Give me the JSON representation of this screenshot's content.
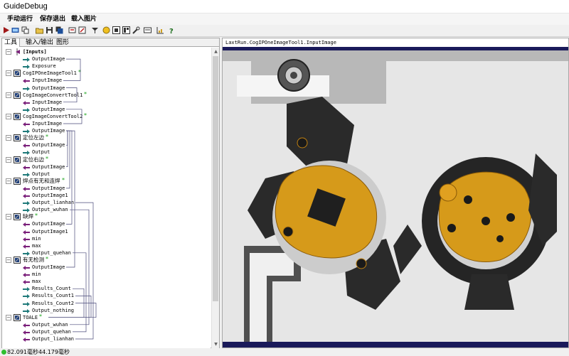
{
  "window": {
    "title": "GuideDebug"
  },
  "menu": [
    {
      "label": "手动运行"
    },
    {
      "label": "保存退出"
    },
    {
      "label": "载入图片"
    }
  ],
  "toolbar_icons": [
    "run-icon",
    "display-icon",
    "copy-icon",
    "open-folder-icon",
    "save-icon",
    "save-all-icon",
    "import-icon",
    "settings-icon",
    "filter-icon",
    "image-icon",
    "grid-icon",
    "layout-icon",
    "keyboard-icon",
    "chart-icon",
    "help-icon"
  ],
  "tabs": [
    {
      "label": "工具",
      "active": true
    },
    {
      "label": "输入/输出",
      "active": false
    },
    {
      "label": "图形",
      "active": false
    }
  ],
  "tree": [
    {
      "type": "group",
      "label": "[Inputs]",
      "bold": true
    },
    {
      "type": "port",
      "dir": "out",
      "label": "OutputImage"
    },
    {
      "type": "port",
      "dir": "out",
      "label": "Exposure"
    },
    {
      "type": "tool",
      "label": "CogIPOneImageTool1",
      "star": true
    },
    {
      "type": "port",
      "dir": "in",
      "label": "InputImage"
    },
    {
      "type": "port",
      "dir": "out",
      "label": "OutputImage"
    },
    {
      "type": "tool",
      "label": "CogImageConvertTool1",
      "star": true
    },
    {
      "type": "port",
      "dir": "in",
      "label": "InputImage"
    },
    {
      "type": "port",
      "dir": "out",
      "label": "OutputImage"
    },
    {
      "type": "tool",
      "label": "CogImageConvertTool2",
      "star": true
    },
    {
      "type": "port",
      "dir": "in",
      "label": "InputImage"
    },
    {
      "type": "port",
      "dir": "out",
      "label": "OutputImage"
    },
    {
      "type": "tool",
      "label": "定位左边",
      "star": true,
      "cn": true
    },
    {
      "type": "port",
      "dir": "in",
      "label": "OutputImage"
    },
    {
      "type": "port",
      "dir": "out",
      "label": "Output"
    },
    {
      "type": "tool",
      "label": "定位右边",
      "star": true,
      "cn": true
    },
    {
      "type": "port",
      "dir": "in",
      "label": "OutputImage"
    },
    {
      "type": "port",
      "dir": "out",
      "label": "Output"
    },
    {
      "type": "tool",
      "label": "焊点有无和连焊",
      "star": true,
      "cn": true
    },
    {
      "type": "port",
      "dir": "in",
      "label": "OutputImage"
    },
    {
      "type": "port",
      "dir": "in",
      "label": "OutputImage1"
    },
    {
      "type": "port",
      "dir": "out",
      "label": "Output_lianhan"
    },
    {
      "type": "port",
      "dir": "out",
      "label": "Output_wuhan"
    },
    {
      "type": "tool",
      "label": "缺焊",
      "star": true,
      "cn": true
    },
    {
      "type": "port",
      "dir": "in",
      "label": "OutputImage"
    },
    {
      "type": "port",
      "dir": "in",
      "label": "OutputImage1"
    },
    {
      "type": "port",
      "dir": "in",
      "label": "min"
    },
    {
      "type": "port",
      "dir": "in",
      "label": "max"
    },
    {
      "type": "port",
      "dir": "out",
      "label": "Output_quehan"
    },
    {
      "type": "tool",
      "label": "有无检测",
      "star": true,
      "cn": true
    },
    {
      "type": "port",
      "dir": "in",
      "label": "OutputImage"
    },
    {
      "type": "port",
      "dir": "in",
      "label": "min"
    },
    {
      "type": "port",
      "dir": "in",
      "label": "max"
    },
    {
      "type": "port",
      "dir": "out",
      "label": "Results_Count"
    },
    {
      "type": "port",
      "dir": "out",
      "label": "Results_Count1"
    },
    {
      "type": "port",
      "dir": "out",
      "label": "Results_Count2"
    },
    {
      "type": "port",
      "dir": "out",
      "label": "Output_nothing"
    },
    {
      "type": "tool",
      "label": "TOALE",
      "star": true
    },
    {
      "type": "port",
      "dir": "in",
      "label": "Output_wuhan"
    },
    {
      "type": "port",
      "dir": "in",
      "label": "Output_quehan"
    },
    {
      "type": "port",
      "dir": "in",
      "label": "Output_lianhan"
    }
  ],
  "image_panel": {
    "title": "LaxtRun.CogIPOneImageTool1.InputImage"
  },
  "status": {
    "text": "82.091毫秒44.179毫秒"
  },
  "colors": {
    "in_arrow": "#7a1f7a",
    "out_arrow": "#1f7a7a",
    "star": "#1aa31a",
    "flex": "#d69a1a",
    "plastic": "#2a2a2a"
  }
}
